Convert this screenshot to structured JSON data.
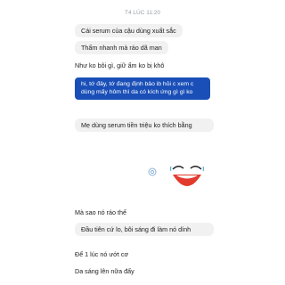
{
  "chat": {
    "timestamp": "T4 LÚC 11:20",
    "messages": [
      {
        "id": "m1",
        "text": "Cái serum của cậu dùng xuất sắc"
      },
      {
        "id": "m2",
        "text": "Thấm nhanh mà ráo dã man"
      },
      {
        "id": "m3",
        "text": "Như ko bôi gì, giữ ẩm ko bị khô"
      },
      {
        "id": "m4",
        "text": "hi, tớ đây, tớ đang định bảo ib hỏi c xem c dùng mấy hôm thì da có kích ứng gì gì ko"
      },
      {
        "id": "m5",
        "text": "Mẹ dùng serum tiền triệu ko thích bằng"
      },
      {
        "id": "m6",
        "text": "Mà sao nó ráo thế"
      },
      {
        "id": "m7",
        "text": "Đầu tiên cứ lo, bôi sáng đi làm nó dính"
      },
      {
        "id": "m8",
        "text": "Để 1 lúc nó ướt cơ"
      },
      {
        "id": "m9",
        "text": "Da sáng lên nữa đấy"
      }
    ],
    "sticker": {
      "icon": "sticker-reaction-icon",
      "face": "laughing-face-sticker"
    }
  },
  "colors": {
    "blue_bubble": "#1a4fb8",
    "grey_bubble": "#f1f1f1",
    "timestamp": "#9aa0a6"
  }
}
